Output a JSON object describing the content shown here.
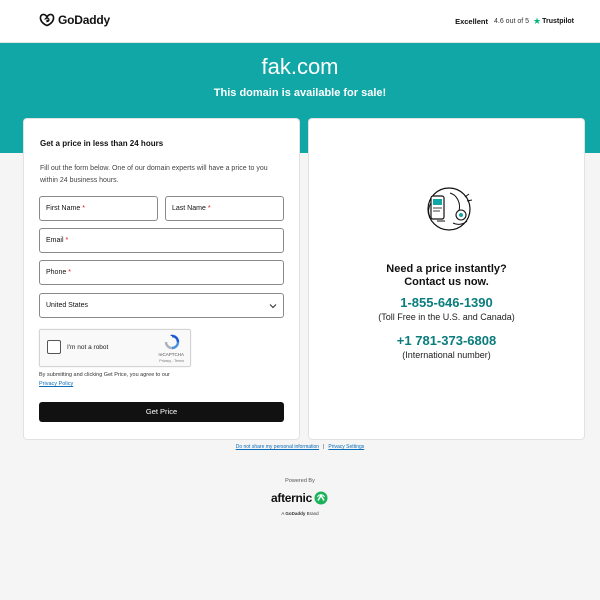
{
  "header": {
    "logo_text": "GoDaddy",
    "trust_label": "Excellent",
    "trust_rating": "4.6 out of 5",
    "trust_brand": "Trustpilot"
  },
  "banner": {
    "domain": "fak.com",
    "subtitle": "This domain is available for sale!"
  },
  "form": {
    "title": "Get a price in less than 24 hours",
    "description": "Fill out the form below. One of our domain experts will have a price to you within 24 business hours.",
    "first_name_label": "First Name",
    "last_name_label": "Last Name",
    "email_label": "Email",
    "phone_label": "Phone",
    "required_mark": "*",
    "country_value": "United States",
    "recaptcha_label": "I'm not a robot",
    "recaptcha_brand": "reCAPTCHA",
    "recaptcha_links": "Privacy - Terms",
    "terms_text": "By submitting and clicking Get Price, you agree to our",
    "privacy_link": "Privacy Policy",
    "submit_label": "Get Price"
  },
  "contact": {
    "heading_line1": "Need a price instantly?",
    "heading_line2": "Contact us now.",
    "tollfree_number": "1-855-646-1390",
    "tollfree_label": "(Toll Free in the U.S. and Canada)",
    "intl_number": "+1 781-373-6808",
    "intl_label": "(International number)"
  },
  "footer": {
    "link_do_not_share": "Do not share my personal information",
    "separator": "|",
    "link_privacy_settings": "Privacy Settings",
    "powered_by": "Powered By",
    "afternic_text": "afternic",
    "brand_prefix": "A",
    "brand_name": "GoDaddy",
    "brand_suffix": "Brand"
  },
  "colors": {
    "teal": "#12a7a7",
    "phone_teal": "#0a7c7c",
    "button": "#111111",
    "trustpilot_green": "#00b67a",
    "afternic_green": "#1ab35b"
  }
}
